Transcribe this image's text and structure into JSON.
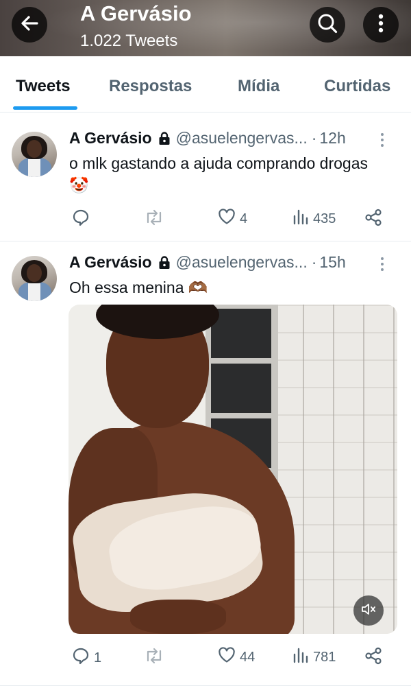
{
  "header": {
    "title": "A Gervásio",
    "subtitle": "1.022 Tweets",
    "icons": [
      "back-arrow-icon",
      "search-icon",
      "more-vertical-icon"
    ]
  },
  "tabs": [
    {
      "label": "Tweets",
      "active": true
    },
    {
      "label": "Respostas",
      "active": false
    },
    {
      "label": "Mídia",
      "active": false
    },
    {
      "label": "Curtidas",
      "active": false
    }
  ],
  "tweets": [
    {
      "name": "A Gervásio",
      "handle": "@asuelengervas...",
      "separator": "·",
      "time": "12h",
      "text": "o mlk gastando a ajuda comprando drogas🤡",
      "replies": "",
      "retweets": "",
      "likes": "4",
      "views": "435"
    },
    {
      "name": "A Gervásio",
      "handle": "@asuelengervas...",
      "separator": "·",
      "time": "15h",
      "text": "Oh essa menina 🫶🏾",
      "replies": "1",
      "retweets": "",
      "likes": "44",
      "views": "781",
      "media": {
        "type": "video",
        "muted": true
      }
    }
  ],
  "colors": {
    "accent": "#1d9bf0",
    "text_primary": "#0f1419",
    "text_secondary": "#536471",
    "divider": "#e6ecf0"
  }
}
